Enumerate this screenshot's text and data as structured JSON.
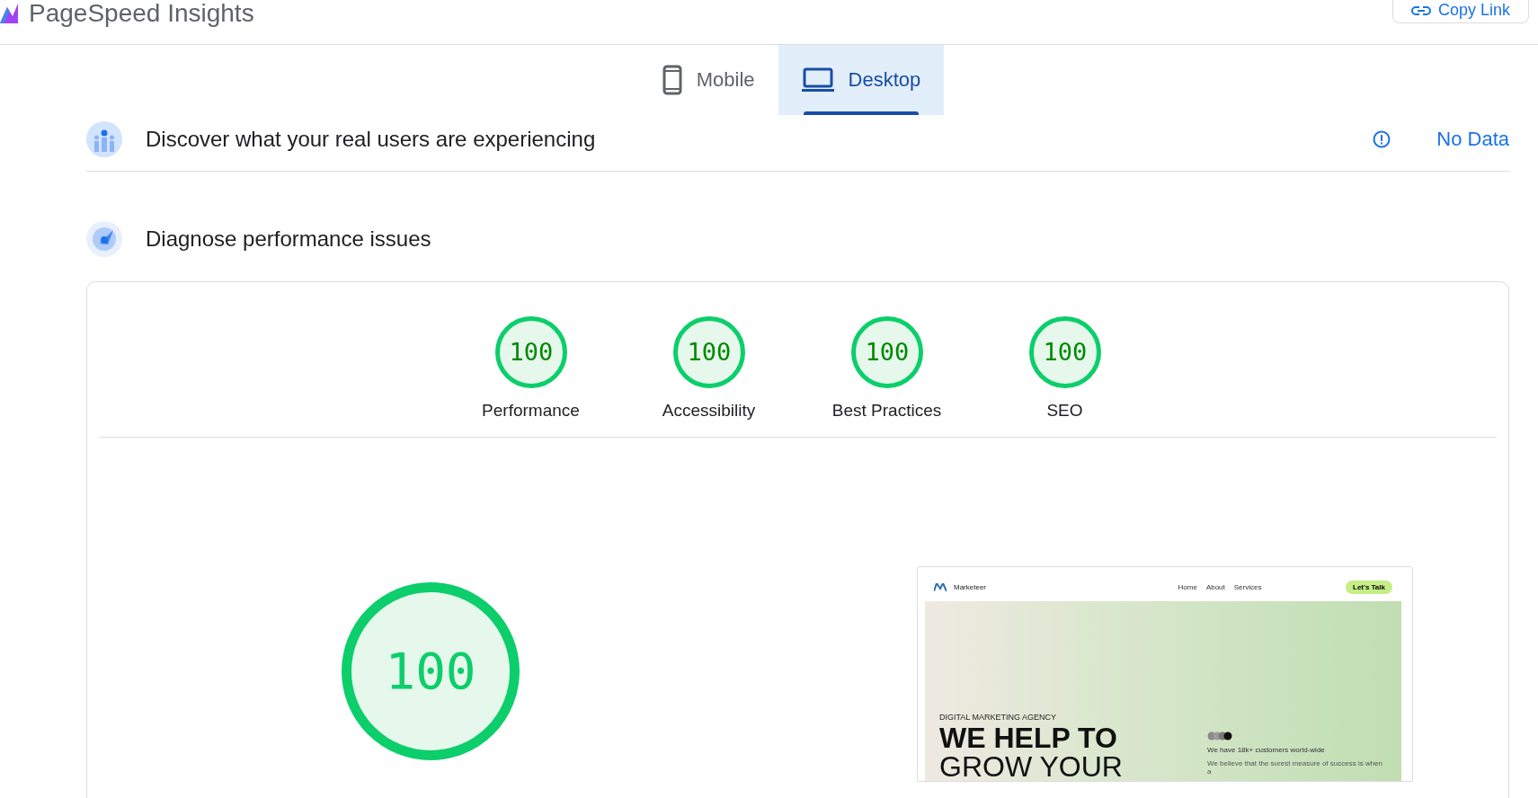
{
  "header": {
    "title": "PageSpeed Insights",
    "copy_link": "Copy Link"
  },
  "tabs": [
    {
      "label": "Mobile",
      "kind": "mobile",
      "selected": false
    },
    {
      "label": "Desktop",
      "kind": "desktop",
      "selected": true
    }
  ],
  "field_section": {
    "title": "Discover what your real users are experiencing",
    "status": "No Data"
  },
  "lab_section": {
    "title": "Diagnose performance issues"
  },
  "scores": [
    {
      "value": "100",
      "label": "Performance",
      "level": 1
    },
    {
      "value": "100",
      "label": "Accessibility",
      "level": 1
    },
    {
      "value": "100",
      "label": "Best Practices",
      "level": 1
    },
    {
      "value": "100",
      "label": "SEO",
      "level": 1
    }
  ],
  "main_score": {
    "value": "100",
    "level": 1
  },
  "preview": {
    "brand": "Marketeer",
    "nav": [
      "Home",
      "About",
      "Services"
    ],
    "cta": "Let's Talk",
    "eyebrow": "DIGITAL MARKETING AGENCY",
    "headline": [
      "WE HELP TO",
      "GROW YOUR"
    ],
    "stat": "We have 18k+ customers world-wide",
    "body": "We believe that the surest measure of success is when a"
  }
}
